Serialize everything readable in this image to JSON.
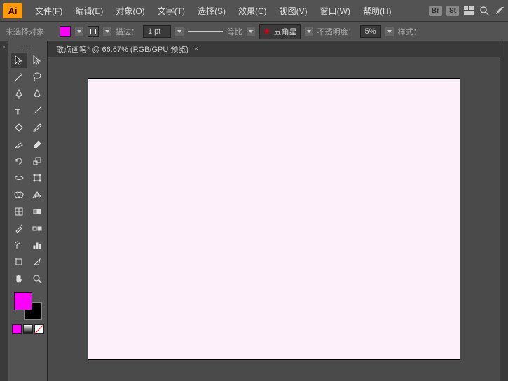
{
  "app": {
    "logo": "Ai"
  },
  "menu": {
    "items": [
      "文件(F)",
      "编辑(E)",
      "对象(O)",
      "文字(T)",
      "选择(S)",
      "效果(C)",
      "视图(V)",
      "窗口(W)",
      "帮助(H)"
    ],
    "badges": [
      "Br",
      "St"
    ]
  },
  "options": {
    "selection": "未选择对象",
    "stroke_label": "描边：",
    "stroke_value": "1 pt",
    "ratio_label": "等比",
    "brush_name": "五角星",
    "opacity_label": "不透明度：",
    "opacity_value": "5%",
    "style_label": "样式："
  },
  "document": {
    "tab_title": "散点画笔* @ 66.67% (RGB/GPU 预览)"
  },
  "colors": {
    "fill": "#ff00ff",
    "stroke": "#000000",
    "canvas_bg": "#fdf0fa"
  },
  "tools": {
    "names": [
      "selection-tool",
      "direct-selection-tool",
      "magic-wand-tool",
      "lasso-tool",
      "pen-tool",
      "curvature-tool",
      "type-tool",
      "line-tool",
      "rectangle-tool",
      "paintbrush-tool",
      "shaper-tool",
      "eraser-tool",
      "rotate-tool",
      "scale-tool",
      "width-tool",
      "free-transform-tool",
      "shape-builder-tool",
      "perspective-grid-tool",
      "mesh-tool",
      "gradient-tool",
      "eyedropper-tool",
      "blend-tool",
      "symbol-sprayer-tool",
      "column-graph-tool",
      "artboard-tool",
      "slice-tool",
      "hand-tool",
      "zoom-tool"
    ]
  }
}
